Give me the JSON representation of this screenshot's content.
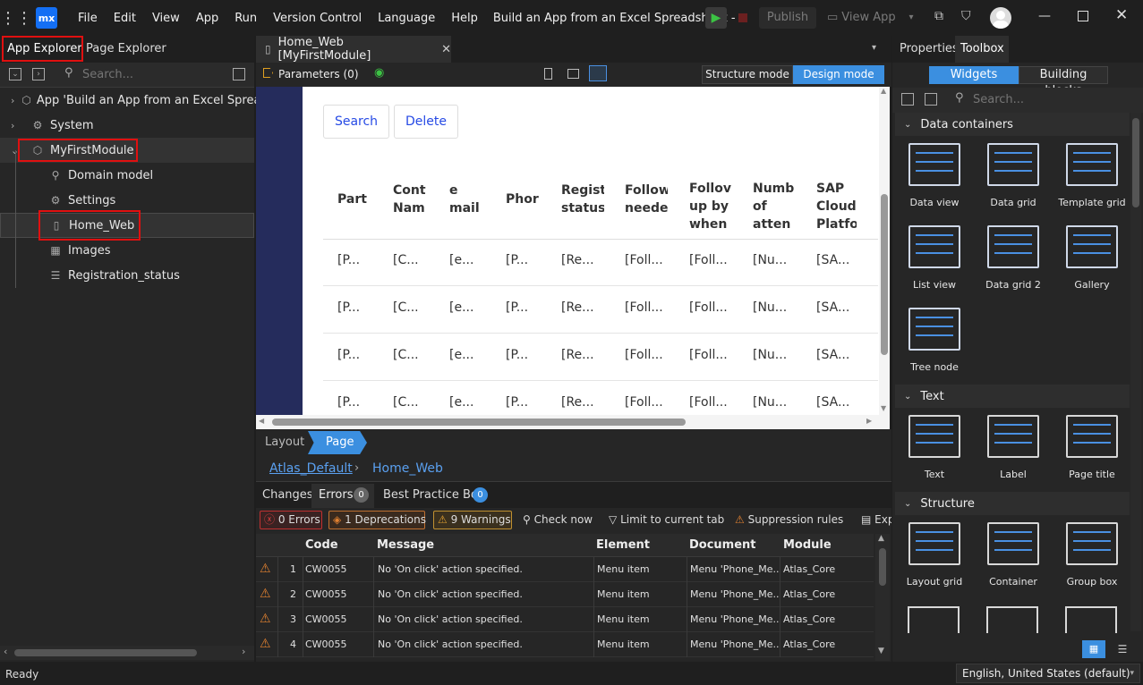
{
  "titlebar": {
    "logo": "mx",
    "menus": [
      "File",
      "Edit",
      "View",
      "App",
      "Run",
      "Version Control",
      "Language",
      "Help"
    ],
    "app_title": "Build an App from an Excel Spreadsheet  -",
    "publish": "Publish",
    "view_app": "View App"
  },
  "left": {
    "tabs": [
      "App Explorer",
      "Page Explorer"
    ],
    "search_placeholder": "Search...",
    "tree": [
      {
        "label": "App 'Build an App from an Excel Spreads",
        "icon": "box-icon"
      },
      {
        "label": "System",
        "icon": "gear-box-icon"
      },
      {
        "label": "MyFirstModule",
        "icon": "module-icon"
      },
      {
        "label": "Domain model",
        "icon": "domain-model-icon"
      },
      {
        "label": "Settings",
        "icon": "gear-icon"
      },
      {
        "label": "Home_Web",
        "icon": "page-icon"
      },
      {
        "label": "Images",
        "icon": "image-icon"
      },
      {
        "label": "Registration_status",
        "icon": "enumeration-icon"
      }
    ]
  },
  "editor": {
    "tab_title": "Home_Web [MyFirstModule]",
    "parameters": "Parameters (0)",
    "modes": [
      "Structure mode",
      "Design mode"
    ],
    "buttons": [
      "Search",
      "Delete"
    ],
    "columns": [
      "Part",
      "Cont\nNam",
      "e\nmail",
      "Phor",
      "Regist\nstatus",
      "Follow\nneede",
      "Follov\nup by\nwhen",
      "Numb\nof\natten",
      "SAP\nCloud\nPlatfo"
    ],
    "rows": [
      [
        "[P...",
        "[C...",
        "[e...",
        "[P...",
        "[Re...",
        "[Foll...",
        "[Foll...",
        "[Nu...",
        "[SA..."
      ],
      [
        "[P...",
        "[C...",
        "[e...",
        "[P...",
        "[Re...",
        "[Foll...",
        "[Foll...",
        "[Nu...",
        "[SA..."
      ],
      [
        "[P...",
        "[C...",
        "[e...",
        "[P...",
        "[Re...",
        "[Foll...",
        "[Foll...",
        "[Nu...",
        "[SA..."
      ],
      [
        "[P...",
        "[C...",
        "[e...",
        "[P...",
        "[Re...",
        "[Foll...",
        "[Foll...",
        "[Nu...",
        "[SA..."
      ]
    ],
    "bottom_tabs": [
      "Layout",
      "Page"
    ],
    "breadcrumb": [
      "Atlas_Default",
      "Home_Web"
    ]
  },
  "errors": {
    "tabs": [
      "Changes",
      "Errors",
      "Best Practice Bot"
    ],
    "errors_count": "0",
    "bot_count": "0",
    "filters": [
      "0 Errors",
      "1 Deprecations",
      "9 Warnings",
      "Check now",
      "Limit to current tab",
      "Suppression rules",
      "Exp"
    ],
    "headers": [
      "Code",
      "Message",
      "Element",
      "Document",
      "Module"
    ],
    "rows": [
      {
        "n": "1",
        "code": "CW0055",
        "msg": "No 'On click' action specified.",
        "el": "Menu item",
        "doc": "Menu 'Phone_Me...",
        "mod": "Atlas_Core"
      },
      {
        "n": "2",
        "code": "CW0055",
        "msg": "No 'On click' action specified.",
        "el": "Menu item",
        "doc": "Menu 'Phone_Me...",
        "mod": "Atlas_Core"
      },
      {
        "n": "3",
        "code": "CW0055",
        "msg": "No 'On click' action specified.",
        "el": "Menu item",
        "doc": "Menu 'Phone_Me...",
        "mod": "Atlas_Core"
      },
      {
        "n": "4",
        "code": "CW0055",
        "msg": "No 'On click' action specified.",
        "el": "Menu item",
        "doc": "Menu 'Phone_Me...",
        "mod": "Atlas_Core"
      }
    ]
  },
  "right": {
    "tabs": [
      "Properties",
      "Toolbox"
    ],
    "subtabs": [
      "Widgets",
      "Building blocks"
    ],
    "search_placeholder": "Search...",
    "sections": [
      {
        "title": "Data containers",
        "items": [
          "Data view",
          "Data grid",
          "Template grid",
          "List view",
          "Data grid 2",
          "Gallery",
          "Tree node"
        ]
      },
      {
        "title": "Text",
        "items": [
          "Text",
          "Label",
          "Page title"
        ]
      },
      {
        "title": "Structure",
        "items": [
          "Layout grid",
          "Container",
          "Group box"
        ]
      }
    ]
  },
  "status": {
    "left": "Ready",
    "language": "English, United States (default)"
  }
}
